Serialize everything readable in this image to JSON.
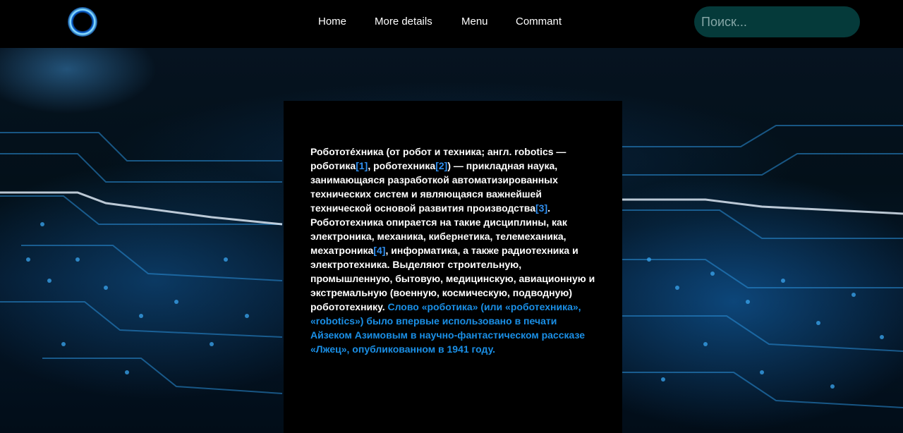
{
  "header": {
    "nav": [
      "Home",
      "More details",
      "Menu",
      "Commant"
    ],
    "search_placeholder": "Поиск..."
  },
  "article": {
    "s1": "Робототе́хника (от робот и техника; англ. robotics — роботика",
    "r1": "[1]",
    "s2": ", роботехника",
    "r2": "[2]",
    "s3": ") — прикладная наука, занимающаяся разработкой автоматизированных технических систем и являющаяся важнейшей технической основой развития производства",
    "r3": "[3]",
    "s4": ". Робототехника опирается на такие дисциплины, как электроника, механика, кибернетика, телемеханика, мехатроника",
    "r4": "[4]",
    "s5": ", информатика, а также радиотехника и электротехника. Выделяют строительную, промышленную, бытовую, медицинскую, авиационную и экстремальную (военную, космическую, подводную) робототехнику. ",
    "highlight": "Слово «роботика» (или «роботехника», «robotics») было впервые использовано в печати Айзеком Азимовым в научно-фантастическом рассказе «Лжец», опубликованном в 1941 году."
  },
  "icons": {
    "logo": "glowing-blue-ring-icon"
  },
  "colors": {
    "header_bg": "#000000",
    "search_bg": "#053a3a",
    "link_blue": "#2f8ff0",
    "highlight_blue": "#1a8fe6"
  }
}
